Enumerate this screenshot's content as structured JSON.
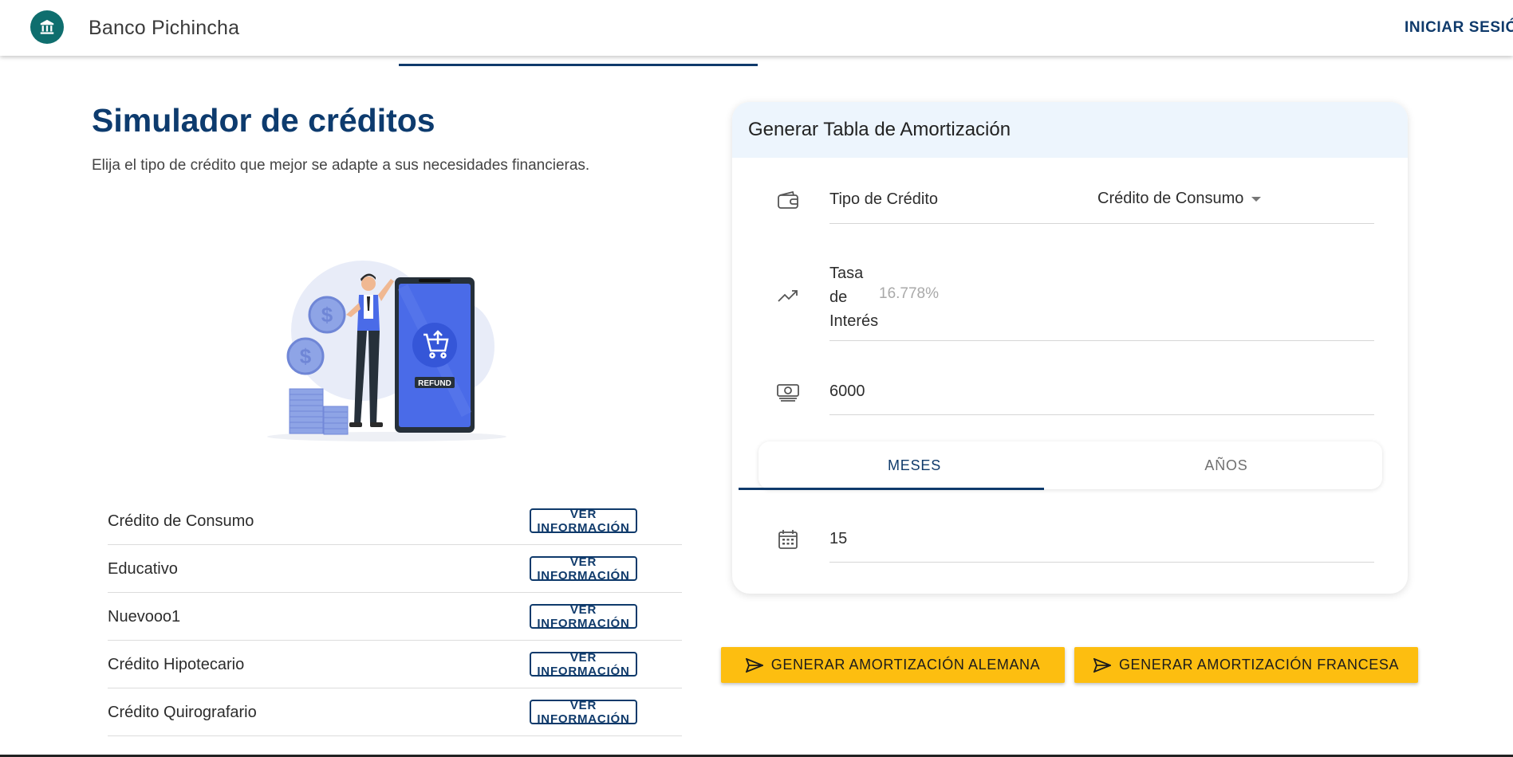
{
  "header": {
    "brand": "Banco Pichincha",
    "logo_icon": "bank-icon",
    "login_label": "INICIAR SESIÓN"
  },
  "main": {
    "title": "Simulador de créditos",
    "subtitle": "Elija el tipo de crédito que mejor se adapte a sus necesidades financieras.",
    "illustration_text": "REFUND",
    "credits": [
      {
        "name": "Crédito de Consumo",
        "button": "VER INFORMACIÓN"
      },
      {
        "name": "Educativo",
        "button": "VER INFORMACIÓN"
      },
      {
        "name": "Nuevooo1",
        "button": "VER INFORMACIÓN"
      },
      {
        "name": "Crédito Hipotecario",
        "button": "VER INFORMACIÓN"
      },
      {
        "name": "Crédito Quirografario",
        "button": "VER INFORMACIÓN"
      }
    ]
  },
  "form": {
    "title": "Generar Tabla de Amortización",
    "credit_type_label": "Tipo de Crédito",
    "credit_type_value": "Crédito de Consumo",
    "rate_label": "Tasa de Interés",
    "rate_placeholder": "16.778%",
    "amount_value": "6000",
    "tabs": [
      "MESES",
      "AÑOS"
    ],
    "active_tab": "MESES",
    "term_value": "15"
  },
  "actions": {
    "german_label": "GENERAR AMORTIZACIÓN ALEMANA",
    "french_label": "GENERAR AMORTIZACIÓN FRANCESA"
  },
  "colors": {
    "primary": "#0f3a6b",
    "accent": "#fdbe10",
    "card_header": "#edf5fd",
    "logo": "#0f6e6e"
  }
}
